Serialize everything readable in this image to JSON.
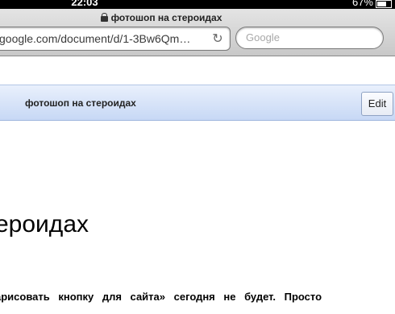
{
  "status_bar": {
    "time": "22:03",
    "battery": "67%"
  },
  "browser": {
    "tab_title": "фотошоп на стероидах",
    "url": "google.com/document/d/1-3Bw6Qm…",
    "search_placeholder": "Google"
  },
  "doc": {
    "header_title": "фотошоп на стероидах",
    "edit_label": "Edit",
    "heading": "ероидах",
    "body_line": "арисовать кнопку для сайта» сегодня не будет. Просто"
  }
}
